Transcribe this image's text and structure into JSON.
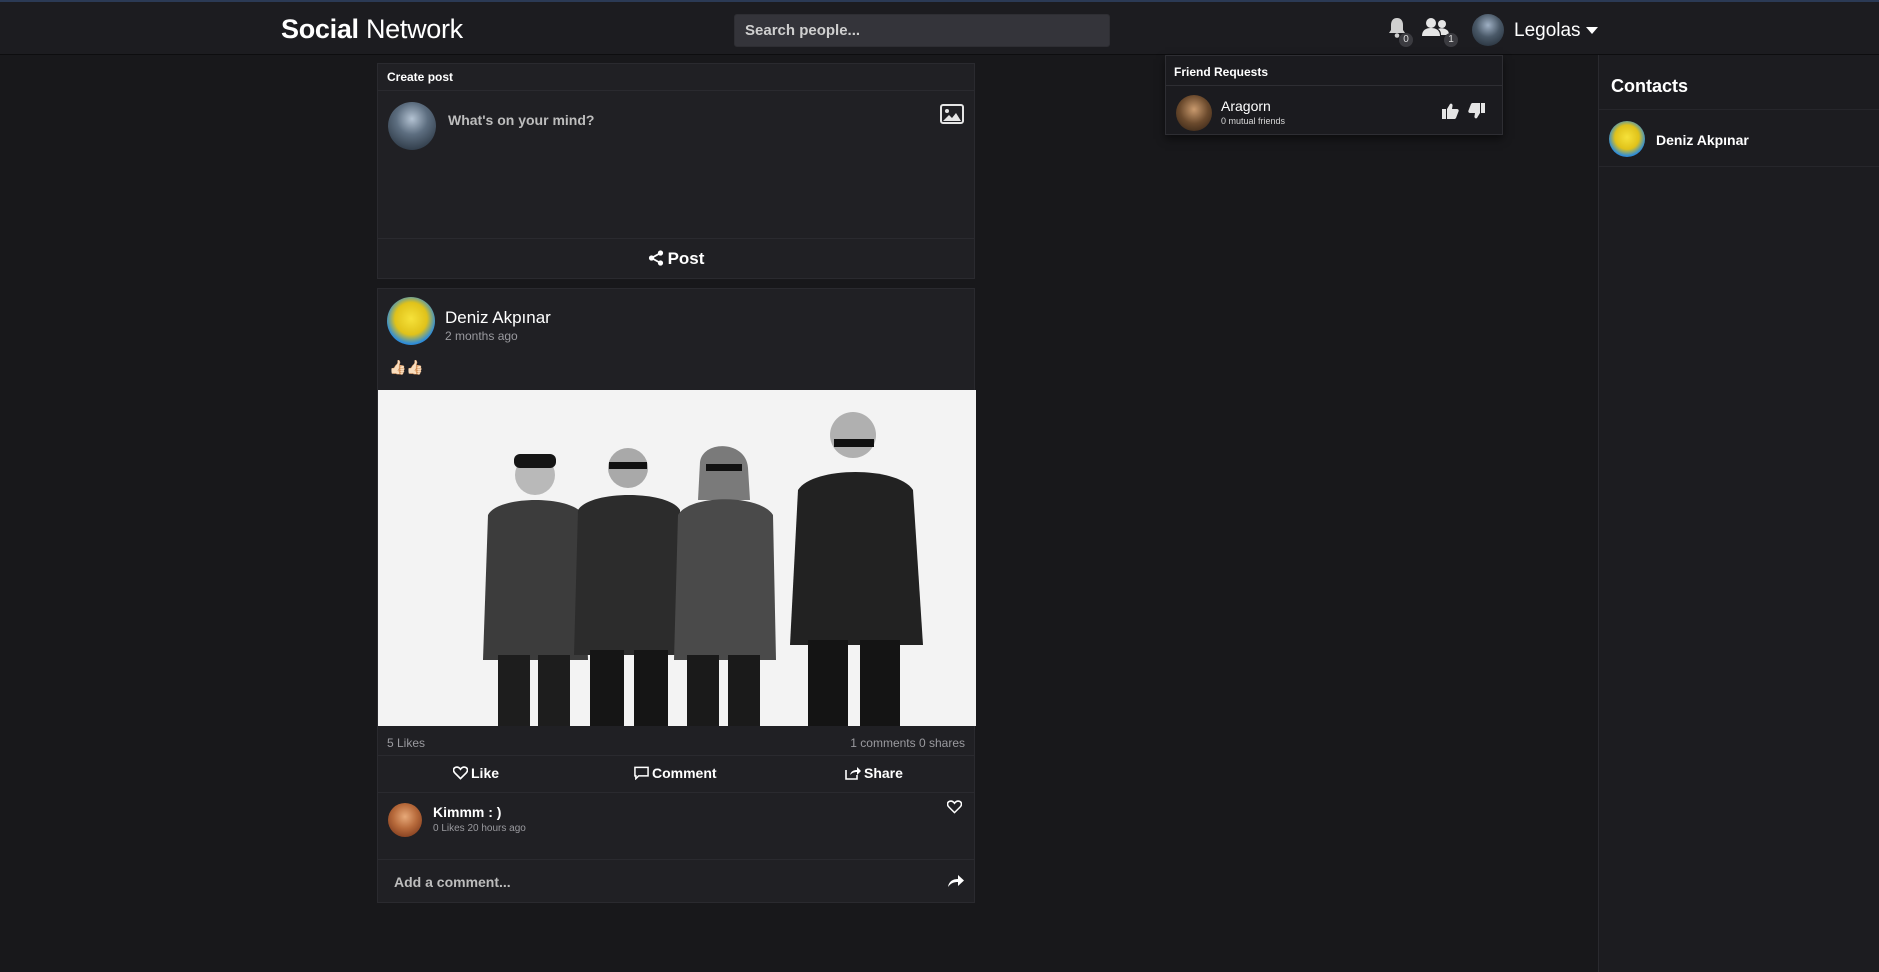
{
  "navbar": {
    "brand_bold": "Social",
    "brand_rest": "Network",
    "search_placeholder": "Search people...",
    "notifications_count": "0",
    "friend_requests_count": "1",
    "user_name": "Legolas"
  },
  "create_post": {
    "title": "Create post",
    "placeholder": "What's on your mind?",
    "post_label": "Post"
  },
  "post": {
    "author": "Deniz Akpınar",
    "time": "2 months ago",
    "text": "👍🏻👍🏻",
    "likes": "5 Likes",
    "comments_shares": "1 comments  0 shares",
    "like_label": "Like",
    "comment_label": "Comment",
    "share_label": "Share",
    "comment": {
      "name": "Kimmm : )",
      "meta": "0 Likes  20 hours ago"
    },
    "add_comment_placeholder": "Add a comment..."
  },
  "friend_requests": {
    "title": "Friend Requests",
    "items": [
      {
        "name": "Aragorn",
        "mutual": "0 mutual friends"
      }
    ]
  },
  "contacts": {
    "title": "Contacts",
    "items": [
      {
        "name": "Deniz Akpınar"
      }
    ]
  },
  "colors": {
    "background": "#18181b",
    "card": "#202024",
    "text": "#ffffff",
    "muted": "#9a9a9f"
  }
}
